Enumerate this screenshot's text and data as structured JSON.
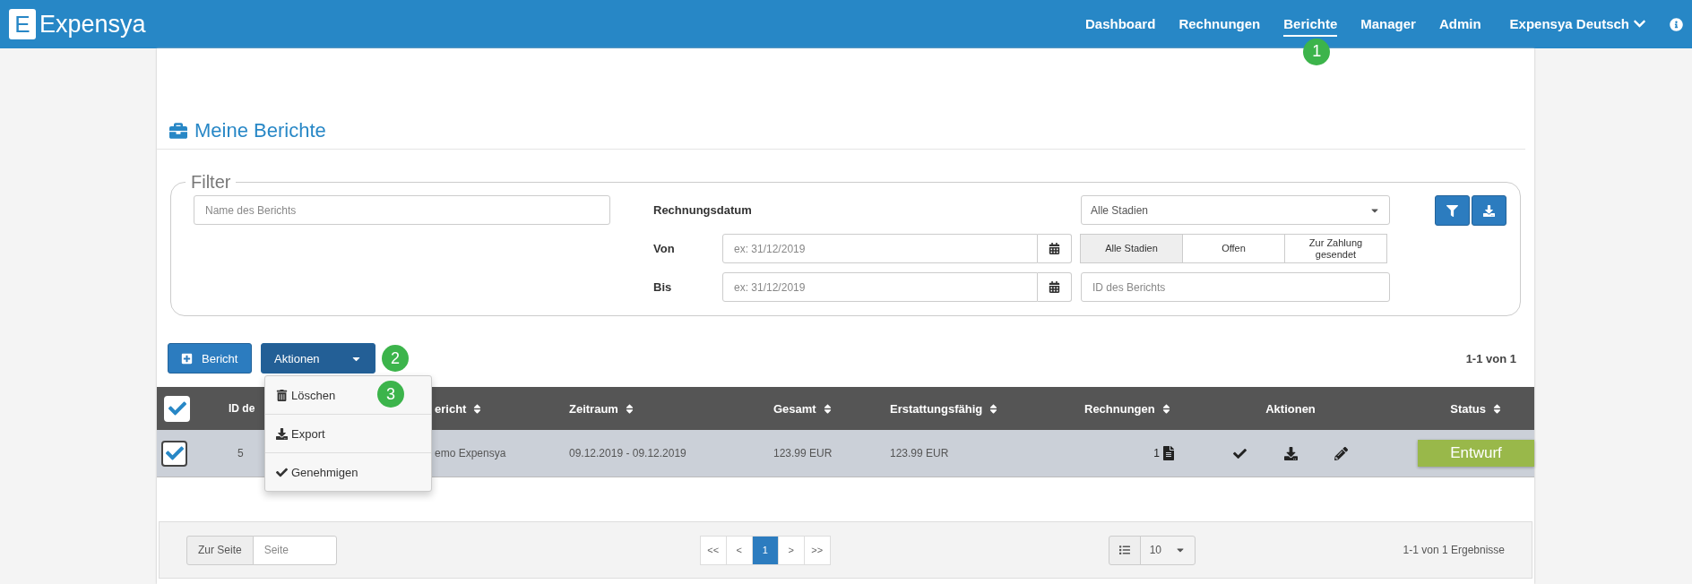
{
  "nav": {
    "brand_letter": "E",
    "brand": "Expensya",
    "items": [
      {
        "label": "Dashboard",
        "selected": false
      },
      {
        "label": "Rechnungen",
        "selected": false
      },
      {
        "label": "Berichte",
        "selected": true,
        "marker": "1"
      },
      {
        "label": "Manager",
        "selected": false
      },
      {
        "label": "Admin",
        "selected": false
      }
    ],
    "language": "Expensya Deutsch"
  },
  "page_title": "Meine Berichte",
  "filter": {
    "legend": "Filter",
    "name_placeholder": "Name des Berichts",
    "date_label": "Rechnungsdatum",
    "from_label": "Von",
    "from_placeholder": "ex: 31/12/2019",
    "to_label": "Bis",
    "to_placeholder": "ex: 31/12/2019",
    "stage_select": "Alle Stadien",
    "stage_buttons": [
      {
        "label": "Alle Stadien",
        "selected": true
      },
      {
        "label": "Offen",
        "selected": false
      },
      {
        "label": "Zur Zahlung gesendet",
        "selected": false
      }
    ],
    "id_placeholder": "ID des Berichts"
  },
  "toolbar": {
    "new_button": "Bericht",
    "actions_button": "Aktionen",
    "actions_marker": "2",
    "count": "1-1 von 1"
  },
  "actions_menu": [
    {
      "kind": "delete",
      "label": "Löschen",
      "marker": "3"
    },
    {
      "kind": "export",
      "label": "Export"
    },
    {
      "kind": "approve",
      "label": "Genehmigen"
    }
  ],
  "table": {
    "all_checked": true,
    "columns": [
      {
        "label": "ID de",
        "sortable": false
      },
      {
        "label": "ericht",
        "sortable": true
      },
      {
        "label": "Zeitraum",
        "sortable": true
      },
      {
        "label": "Gesamt",
        "sortable": true
      },
      {
        "label": "Erstattungsfähig",
        "sortable": true
      },
      {
        "label": "Rechnungen",
        "sortable": true
      },
      {
        "label": "Aktionen",
        "sortable": false
      },
      {
        "label": "Status",
        "sortable": true
      }
    ],
    "rows": [
      {
        "checked": true,
        "id": "5",
        "name": "emo Expensya",
        "period": "09.12.2019 - 09.12.2019",
        "total": "123.99 EUR",
        "refundable": "123.99 EUR",
        "invoices": "1",
        "status": "Entwurf"
      }
    ]
  },
  "pagination": {
    "goto_label": "Zur Seite",
    "page_placeholder": "Seite",
    "pages": [
      {
        "label": "<<",
        "selected": false
      },
      {
        "label": "<",
        "selected": false
      },
      {
        "label": "1",
        "selected": true
      },
      {
        "label": ">",
        "selected": false
      },
      {
        "label": ">>",
        "selected": false
      }
    ],
    "page_size": "10",
    "summary": "1-1 von 1 Ergebnisse"
  }
}
